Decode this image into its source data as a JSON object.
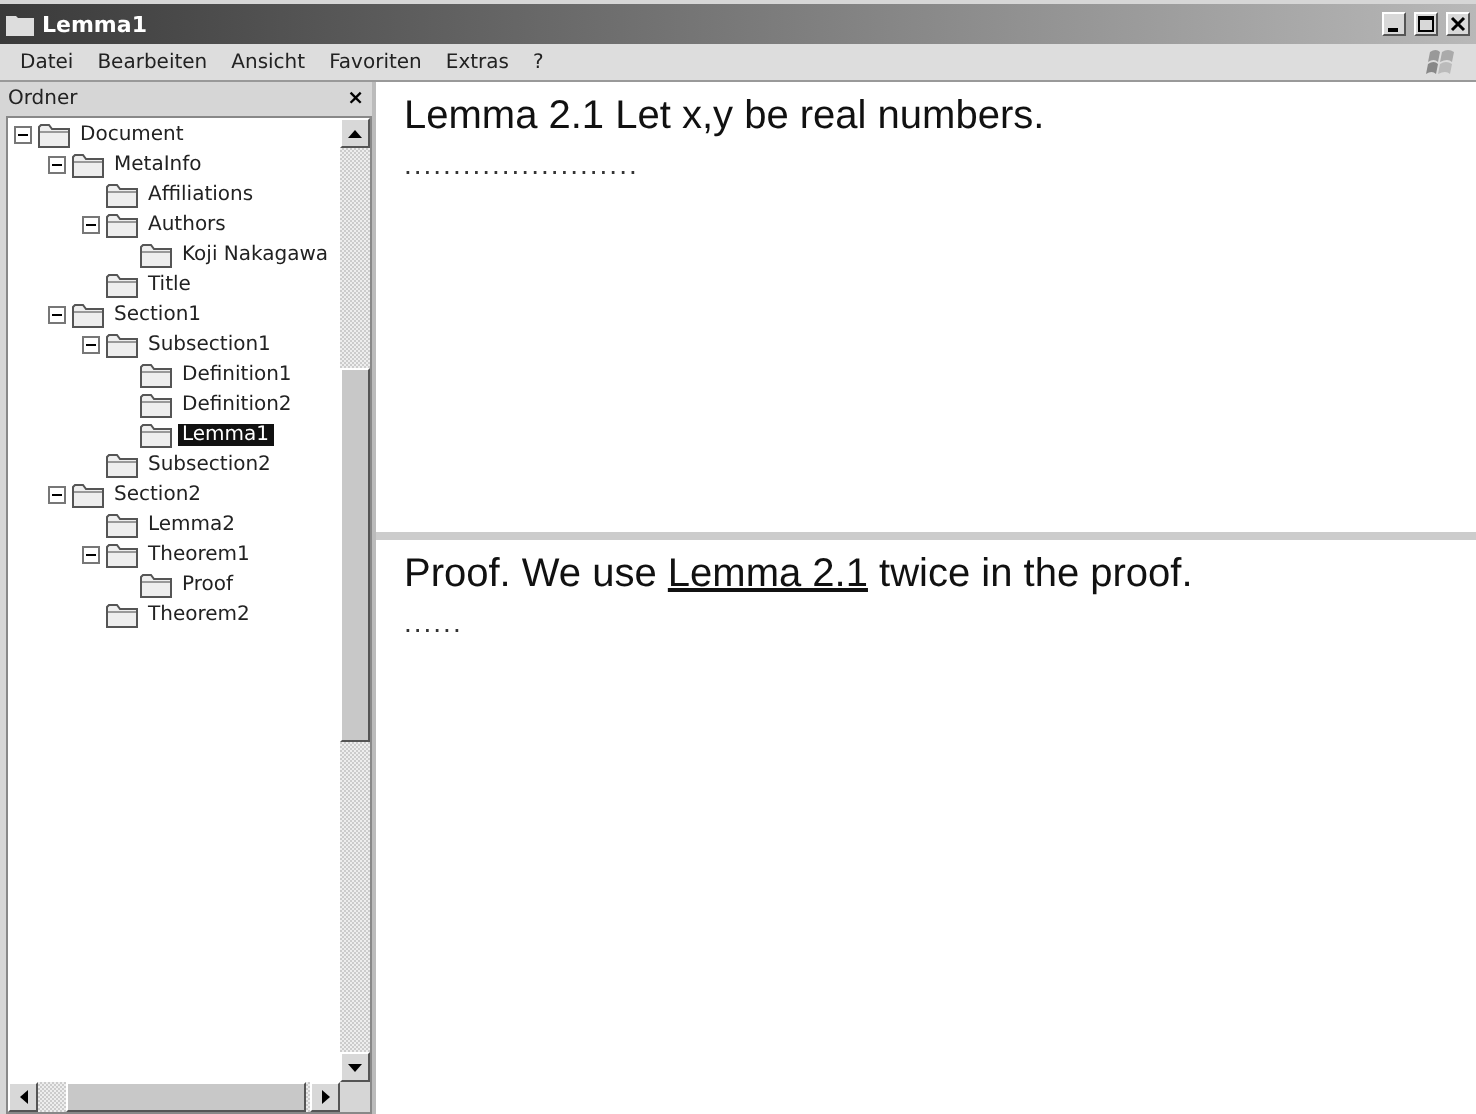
{
  "window": {
    "title": "Lemma1"
  },
  "menu": [
    "Datei",
    "Bearbeiten",
    "Ansicht",
    "Favoriten",
    "Extras",
    "?"
  ],
  "sidebar": {
    "title": "Ordner",
    "close": "×",
    "tree": [
      {
        "label": "Document",
        "expanded": true,
        "selected": false,
        "children": [
          {
            "label": "MetaInfo",
            "expanded": true,
            "selected": false,
            "children": [
              {
                "label": "Affiliations",
                "selected": false
              },
              {
                "label": "Authors",
                "expanded": true,
                "selected": false,
                "children": [
                  {
                    "label": "Koji Nakagawa",
                    "selected": false
                  }
                ]
              },
              {
                "label": "Title",
                "selected": false
              }
            ]
          },
          {
            "label": "Section1",
            "expanded": true,
            "selected": false,
            "children": [
              {
                "label": "Subsection1",
                "expanded": true,
                "selected": false,
                "children": [
                  {
                    "label": "Definition1",
                    "selected": false
                  },
                  {
                    "label": "Definition2",
                    "selected": false
                  },
                  {
                    "label": "Lemma1",
                    "selected": true
                  }
                ]
              },
              {
                "label": "Subsection2",
                "selected": false
              }
            ]
          },
          {
            "label": "Section2",
            "expanded": true,
            "selected": false,
            "children": [
              {
                "label": "Lemma2",
                "selected": false
              },
              {
                "label": "Theorem1",
                "expanded": true,
                "selected": false,
                "children": [
                  {
                    "label": "Proof",
                    "selected": false
                  }
                ]
              },
              {
                "label": "Theorem2",
                "selected": false
              }
            ]
          }
        ]
      }
    ]
  },
  "top_pane": {
    "heading": "Lemma 2.1 Let x,y be real numbers.",
    "dots": "........................"
  },
  "bottom_pane": {
    "before": "Proof. We use",
    "link": "Lemma 2.1",
    "after": "twice in the proof.",
    "dots": "......"
  }
}
